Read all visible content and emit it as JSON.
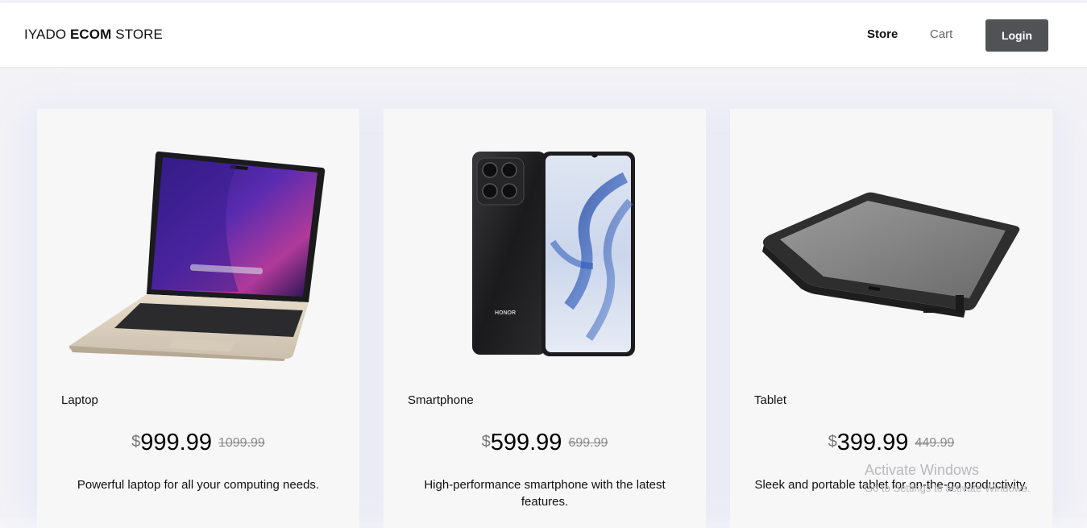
{
  "header": {
    "brand_prefix": "IYADO",
    "brand_bold": "ECOM",
    "brand_suffix": "STORE",
    "nav": {
      "store": "Store",
      "cart": "Cart",
      "login": "Login"
    }
  },
  "products": [
    {
      "name": "Laptop",
      "currency": "$",
      "price": "999.99",
      "old_price": "1099.99",
      "description": "Powerful laptop for all your computing needs.",
      "image": "laptop-image"
    },
    {
      "name": "Smartphone",
      "currency": "$",
      "price": "599.99",
      "old_price": "699.99",
      "description": "High-performance smartphone with the latest features.",
      "image": "smartphone-image",
      "image_text": "HONOR"
    },
    {
      "name": "Tablet",
      "currency": "$",
      "price": "399.99",
      "old_price": "449.99",
      "description": "Sleek and portable tablet for on-the-go productivity.",
      "image": "tablet-image"
    }
  ],
  "overlay": {
    "activate_title": "Activate Windows",
    "activate_sub": "Go to Settings to activate Windows."
  },
  "colors": {
    "login_button": "#505256",
    "card_background": "#f7f7f8",
    "page_background": "#f3f3f7"
  }
}
